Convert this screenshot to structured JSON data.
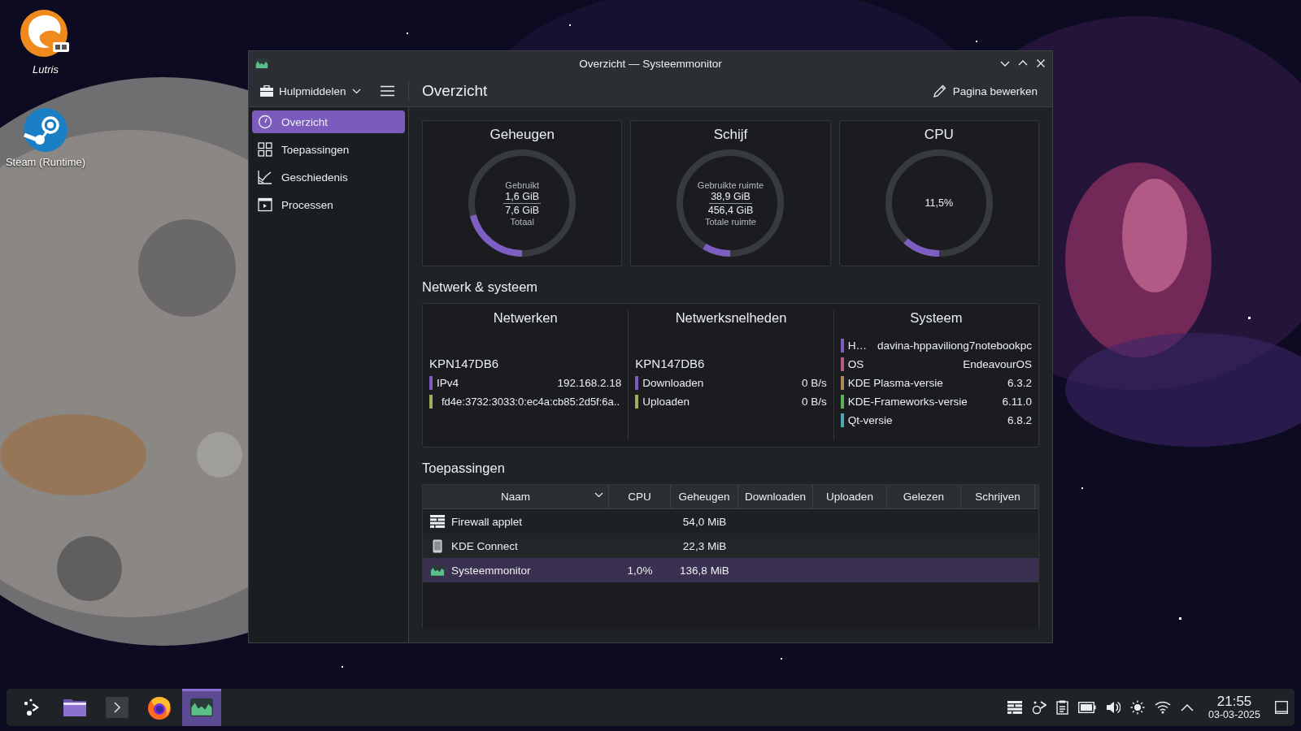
{
  "desktop_icons": [
    {
      "label": "Lutris",
      "kind": "lutris"
    },
    {
      "label": "Steam (Runtime)",
      "kind": "steam"
    }
  ],
  "window": {
    "title": "Overzicht — Systeemmonitor"
  },
  "toolbar": {
    "tools_label": "Hulpmiddelen",
    "page_title": "Overzicht",
    "edit_button": "Pagina bewerken"
  },
  "sidebar": {
    "items": [
      {
        "label": "Overzicht",
        "kind": "gauge",
        "selected": true
      },
      {
        "label": "Toepassingen",
        "kind": "grid",
        "selected": false
      },
      {
        "label": "Geschiedenis",
        "kind": "chart",
        "selected": false
      },
      {
        "label": "Processen",
        "kind": "process",
        "selected": false
      }
    ]
  },
  "gauges": [
    {
      "title": "Geheugen",
      "top_label": "Gebruikt",
      "value": "1,6 GiB",
      "total": "7,6 GiB",
      "bottom_label": "Totaal",
      "level": 0.21
    },
    {
      "title": "Schijf",
      "top_label": "Gebruikte ruimte",
      "value": "38,9 GiB",
      "total": "456,4 GiB",
      "bottom_label": "Totale ruimte",
      "level": 0.085
    },
    {
      "title": "CPU",
      "value": "11,5%",
      "level": 0.115
    }
  ],
  "network_section": {
    "title": "Netwerk & systeem",
    "columns": [
      {
        "title": "Netwerken",
        "name": "KPN147DB6",
        "rows": [
          {
            "label": "IPv4",
            "value": "192.168.2.18",
            "color": "#7e5cc0"
          },
          {
            "value": "fd4e:3732:3033:0:ec4a:cb85:2d5f:6a..",
            "color": "#a4ac5c"
          }
        ]
      },
      {
        "title": "Netwerksnelheden",
        "name": "KPN147DB6",
        "rows": [
          {
            "label": "Downloaden",
            "value": "0 B/s",
            "color": "#7e5cc0"
          },
          {
            "label": "Uploaden",
            "value": "0 B/s",
            "color": "#a4ac5c"
          }
        ]
      },
      {
        "title": "Systeem",
        "rows": [
          {
            "label": "H…",
            "value": "davina-hppaviliong7notebookpc",
            "color": "#7e5cc0"
          },
          {
            "label": "OS",
            "value": "EndeavourOS",
            "color": "#b55a82"
          },
          {
            "label": "KDE Plasma-versie",
            "value": "6.3.2",
            "color": "#a98c5a"
          },
          {
            "label": "KDE-Frameworks-versie",
            "value": "6.11.0",
            "color": "#5fae5a"
          },
          {
            "label": "Qt-versie",
            "value": "6.8.2",
            "color": "#4fa6ae"
          }
        ]
      }
    ]
  },
  "applications": {
    "title": "Toepassingen",
    "columns": [
      "Naam",
      "CPU",
      "Geheugen",
      "Downloaden",
      "Uploaden",
      "Gelezen",
      "Schrijven"
    ],
    "rows": [
      {
        "kind": "firewall",
        "name": "Firewall applet",
        "memory": "54,0 MiB",
        "selected": false
      },
      {
        "kind": "connect",
        "name": "KDE Connect",
        "memory": "22,3 MiB",
        "selected": false
      },
      {
        "kind": "monitor",
        "name": "Systeemmonitor",
        "cpu": "1,0%",
        "memory": "136,8 MiB",
        "selected": true
      }
    ]
  },
  "taskbar": {
    "apps": [
      {
        "kind": "launcher",
        "selected": false
      },
      {
        "kind": "files",
        "selected": false
      },
      {
        "kind": "terminal",
        "selected": false
      },
      {
        "kind": "browser",
        "selected": false
      },
      {
        "kind": "monitor",
        "selected": true
      }
    ],
    "tray": [
      {
        "kind": "firewall"
      },
      {
        "kind": "connect"
      },
      {
        "kind": "clipboard"
      },
      {
        "kind": "battery"
      },
      {
        "kind": "volume"
      },
      {
        "kind": "brightness"
      },
      {
        "kind": "wifi"
      },
      {
        "kind": "expand"
      }
    ],
    "time": "21:55",
    "date": "03-03-2025"
  }
}
